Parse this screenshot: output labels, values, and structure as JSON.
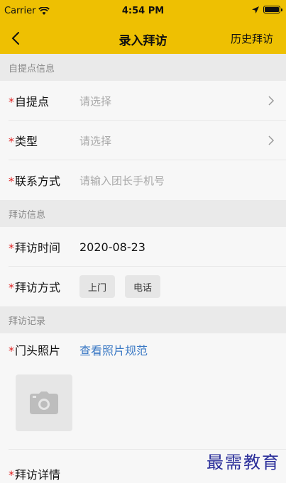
{
  "status_bar": {
    "carrier": "Carrier",
    "time": "4:54 PM"
  },
  "nav": {
    "title": "录入拜访",
    "history": "历史拜访"
  },
  "sections": {
    "pickup_info": "自提点信息",
    "visit_info": "拜访信息",
    "visit_record": "拜访记录"
  },
  "fields": {
    "pickup_point": {
      "label": "自提点",
      "placeholder": "请选择"
    },
    "type": {
      "label": "类型",
      "placeholder": "请选择"
    },
    "contact": {
      "label": "联系方式",
      "placeholder": "请输入团长手机号"
    },
    "visit_time": {
      "label": "拜访时间",
      "value": "2020-08-23"
    },
    "visit_method": {
      "label": "拜访方式",
      "options": [
        "上门",
        "电话"
      ]
    },
    "door_photo": {
      "label": "门头照片",
      "link": "查看照片规范"
    },
    "visit_details": {
      "label": "拜访详情"
    }
  },
  "required_mark": "*",
  "watermark": "最需教育",
  "colors": {
    "header": "#eec002",
    "link": "#3a78c4",
    "required": "#e02020"
  }
}
